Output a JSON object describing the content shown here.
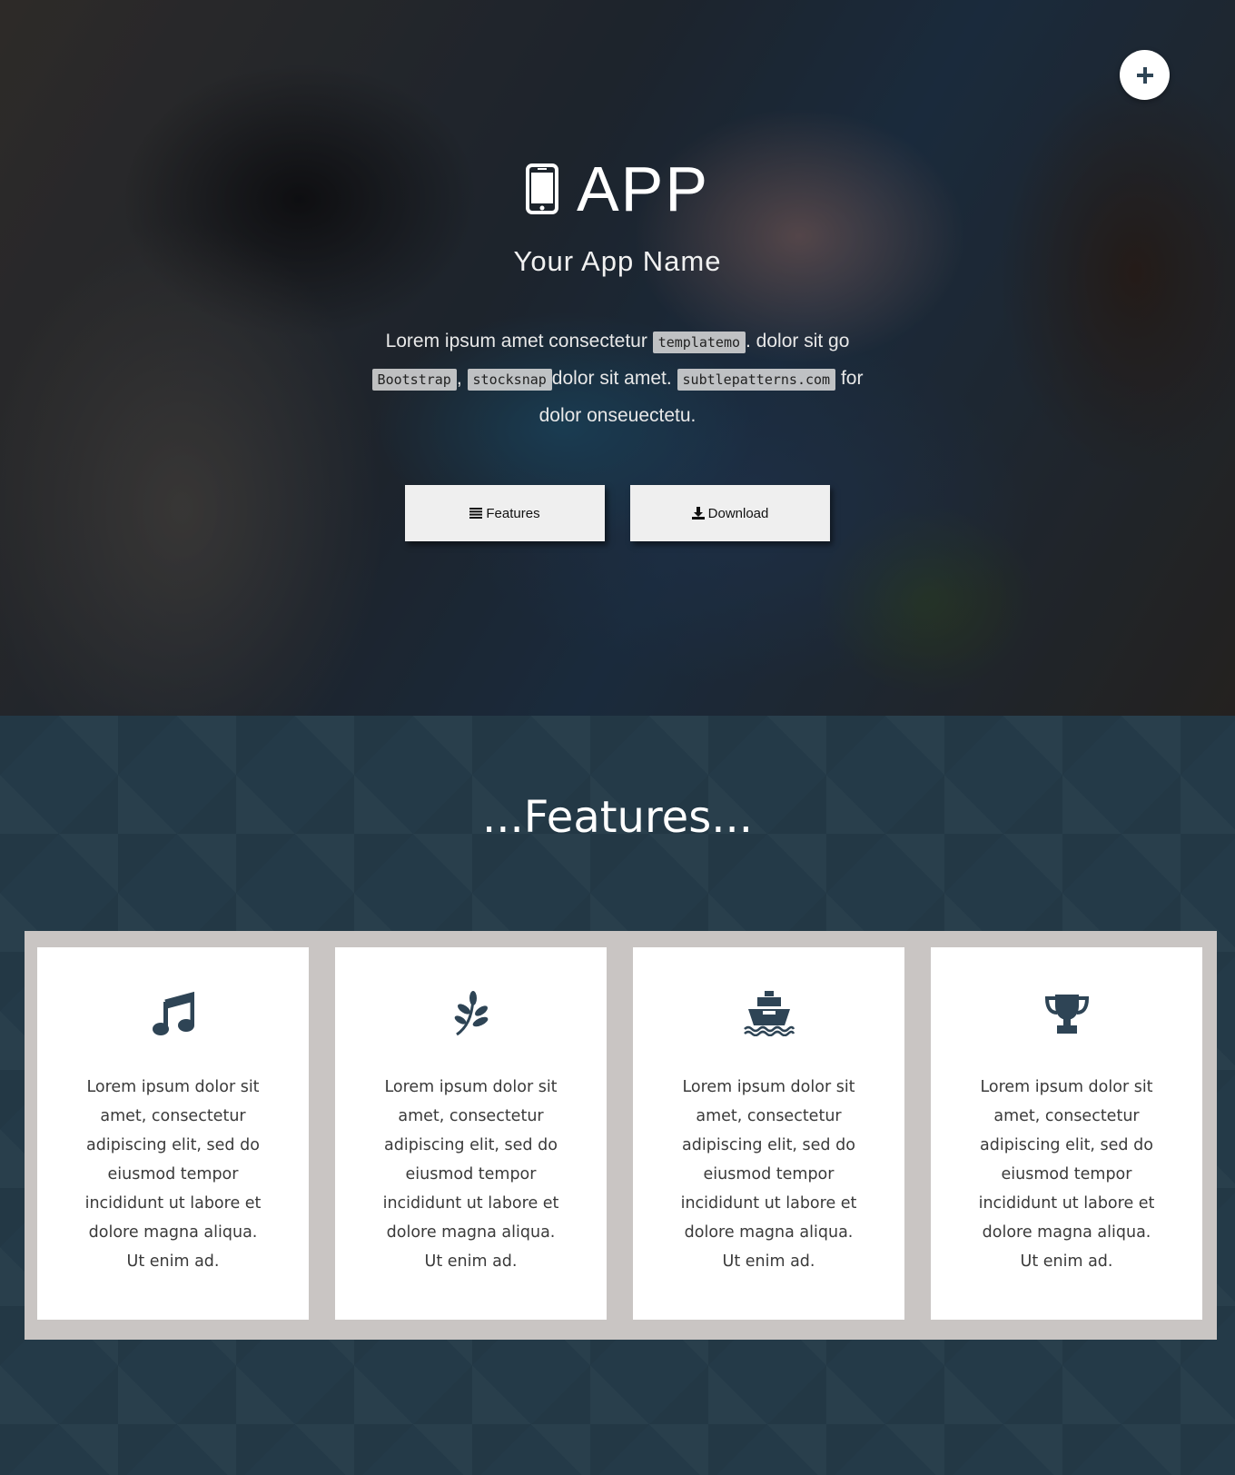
{
  "hero": {
    "title": "APP",
    "subtitle": "Your App Name",
    "desc_1": "Lorem ipsum amet consectetur",
    "code_1": "templatemo",
    "desc_2": ". dolor sit go",
    "code_2": "Bootstrap",
    "desc_3": ",",
    "code_3": "stocksnap",
    "desc_4": "dolor sit amet.",
    "code_4": "subtlepatterns.com",
    "desc_5": "for dolor onseuectetu.",
    "features_button": "Features",
    "download_button": "Download",
    "plus_icon": "plus-icon"
  },
  "features": {
    "title": "...Features...",
    "cards": [
      {
        "icon": "music-icon",
        "text": "Lorem ipsum dolor sit amet, consectetur adipiscing elit, sed do eiusmod tempor incididunt ut labore et dolore magna aliqua. Ut enim ad."
      },
      {
        "icon": "leaf-icon",
        "text": "Lorem ipsum dolor sit amet, consectetur adipiscing elit, sed do eiusmod tempor incididunt ut labore et dolore magna aliqua. Ut enim ad."
      },
      {
        "icon": "ship-icon",
        "text": "Lorem ipsum dolor sit amet, consectetur adipiscing elit, sed do eiusmod tempor incididunt ut labore et dolore magna aliqua. Ut enim ad."
      },
      {
        "icon": "trophy-icon",
        "text": "Lorem ipsum dolor sit amet, consectetur adipiscing elit, sed do eiusmod tempor incididunt ut labore et dolore magna aliqua. Ut enim ad."
      }
    ]
  },
  "colors": {
    "icon": "#2e4455",
    "section_bg": "#243a48",
    "card_frame": "#c9c5c3"
  }
}
